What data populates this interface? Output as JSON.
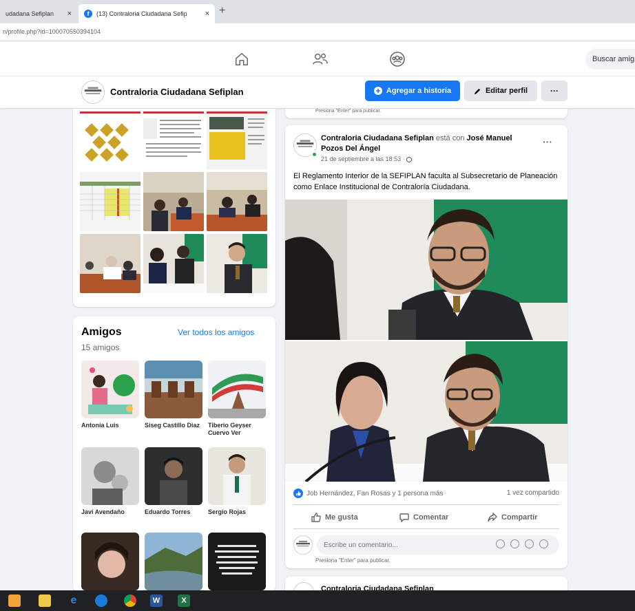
{
  "browser": {
    "tab_inactive": "udadana Sefiplan",
    "tab_active": "(13) Contraloria Ciudadana Sefip",
    "tab_close": "×",
    "new_tab": "+",
    "url": "n/profile.php?id=100070550394104"
  },
  "nav": {
    "search": "Buscar amig"
  },
  "profile": {
    "name": "Contraloria Ciudadana Sefiplan",
    "story_button": "Agregar a historia",
    "edit_button": "Editar perfil",
    "more_button": "···"
  },
  "prev_post_hint": "Presiona \"Enter\" para publicar.",
  "friends": {
    "title": "Amigos",
    "count": "15 amigos",
    "see_all": "Ver todos los amigos",
    "list": [
      {
        "name": "Antonia Luis"
      },
      {
        "name": "Siseg Castillo Diaz"
      },
      {
        "name": "Tiberio Geyser Cuervo Ver"
      },
      {
        "name": "Javi Avendaño"
      },
      {
        "name": "Eduardo Torres"
      },
      {
        "name": "Sergio Rojas"
      }
    ]
  },
  "post": {
    "author": "Contraloria Ciudadana Sefiplan",
    "with_text": "está con",
    "tagged": "José Manuel Pozos Del Ángel",
    "time": "21 de septiembre a las 18:53 · ",
    "more": "···",
    "text": "El Reglamento Interior de la SEFIPLAN faculta al Subsecretario de Planeación como Enlace Institucional de Contraloría Ciudadana.",
    "reactions": "Job Hernández, Fan Rosas y 1 persona más",
    "shares": "1 vez compartido",
    "like": "Me gusta",
    "comment": "Comentar",
    "share": "Compartir",
    "comment_placeholder": "Escribe un comentario...",
    "enter_hint": "Presiona \"Enter\" para publicar."
  },
  "next_post": {
    "author": "Contraloria Ciudadana Sefiplan"
  },
  "colors": {
    "fb_blue": "#1877f2",
    "background": "#f0f2f5",
    "green_wall": "#1f8a5a"
  }
}
